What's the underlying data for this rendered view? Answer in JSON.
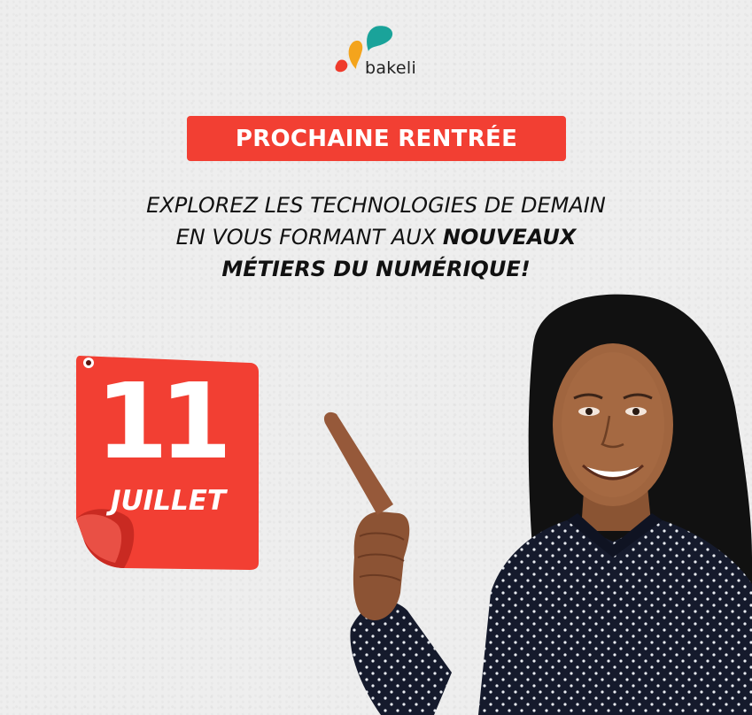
{
  "brand": {
    "name": "bakeli",
    "icon": "bakeli-splash-logo"
  },
  "banner": {
    "label": "PROCHAINE RENTRÉE",
    "color": "#f23f33"
  },
  "headline": {
    "line1": "EXPLOREZ LES TECHNOLOGIES DE DEMAIN",
    "line2_regular": "EN VOUS FORMANT AUX ",
    "line2_bold": "NOUVEAUX",
    "line3_bold": "MÉTIERS DU NUMÉRIQUE!"
  },
  "date": {
    "day": "11",
    "month": "JUILLET",
    "icon": "calendar-page-icon"
  },
  "photo": {
    "subject": "woman-pointing"
  }
}
